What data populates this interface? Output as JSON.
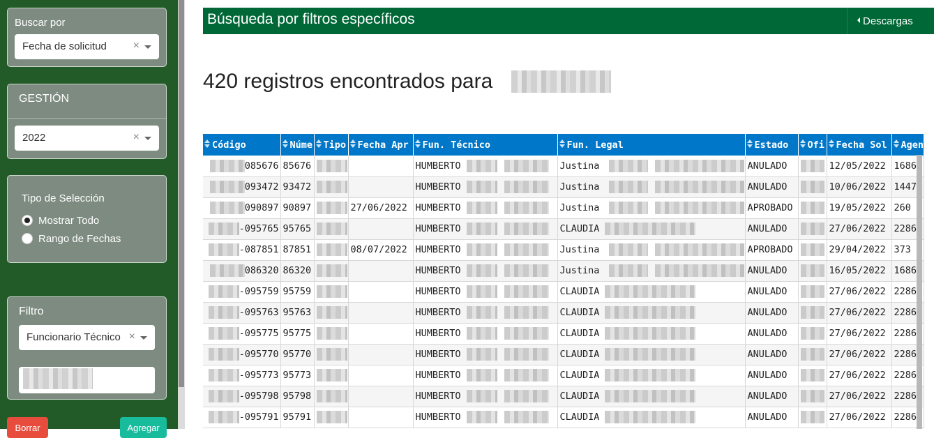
{
  "sidebar": {
    "buscar_por": {
      "label": "Buscar por",
      "value": "Fecha de solicitud",
      "clear": "×"
    },
    "gestion": {
      "label": "GESTIÓN",
      "value": "2022",
      "clear": "×"
    },
    "tipo_seleccion": {
      "label": "Tipo de Selección",
      "options": [
        {
          "label": "Mostrar Todo",
          "checked": true
        },
        {
          "label": "Rango de Fechas",
          "checked": false
        }
      ]
    },
    "filtro": {
      "label": "Filtro",
      "value": "Funcionario Técnico",
      "clear": "×",
      "text_value": ""
    },
    "buttons": {
      "borrar": "Borrar",
      "agregar": "Agregar"
    },
    "colors": {
      "bg": "#235b28",
      "panel": "#7d8b80",
      "borrar": "#e74c3c",
      "agregar": "#18bc9c"
    }
  },
  "header": {
    "title": "Búsqueda por filtros específicos",
    "download_button": "Descargas",
    "color": "#006837"
  },
  "results": {
    "count_text": "420 registros encontrados para"
  },
  "table": {
    "header_color": "#0077c8",
    "columns": [
      "Código",
      "Núme",
      "Tipo",
      "Fecha Apr",
      "Fun. Técnico",
      "Fun. Legal",
      "Estado",
      "Ofi",
      "Fecha Sol",
      "Agen"
    ],
    "rows": [
      {
        "codigo": "085676",
        "numero": "85676",
        "fecha_apr": "",
        "tecnico": "HUMBERTO",
        "legal": "Justina",
        "estado": "ANULADO",
        "fecha_sol": "12/05/2022",
        "agencia": "1686"
      },
      {
        "codigo": "093472",
        "numero": "93472",
        "fecha_apr": "",
        "tecnico": "HUMBERTO",
        "legal": "Justina",
        "estado": "ANULADO",
        "fecha_sol": "10/06/2022",
        "agencia": "1447"
      },
      {
        "codigo": "090897",
        "numero": "90897",
        "fecha_apr": "27/06/2022",
        "tecnico": "HUMBERTO",
        "legal": "Justina",
        "estado": "APROBADO",
        "fecha_sol": "19/05/2022",
        "agencia": "260"
      },
      {
        "codigo": "-095765",
        "numero": "95765",
        "fecha_apr": "",
        "tecnico": "HUMBERTO",
        "legal": "CLAUDIA",
        "estado": "ANULADO",
        "fecha_sol": "27/06/2022",
        "agencia": "2286"
      },
      {
        "codigo": "-087851",
        "numero": "87851",
        "fecha_apr": "08/07/2022",
        "tecnico": "HUMBERTO",
        "legal": "Justina",
        "estado": "APROBADO",
        "fecha_sol": "29/04/2022",
        "agencia": "373"
      },
      {
        "codigo": "086320",
        "numero": "86320",
        "fecha_apr": "",
        "tecnico": "HUMBERTO",
        "legal": "Justina",
        "estado": "ANULADO",
        "fecha_sol": "16/05/2022",
        "agencia": "1686"
      },
      {
        "codigo": "-095759",
        "numero": "95759",
        "fecha_apr": "",
        "tecnico": "HUMBERTO",
        "legal": "CLAUDIA",
        "estado": "ANULADO",
        "fecha_sol": "27/06/2022",
        "agencia": "2286"
      },
      {
        "codigo": "-095763",
        "numero": "95763",
        "fecha_apr": "",
        "tecnico": "HUMBERTO",
        "legal": "CLAUDIA",
        "estado": "ANULADO",
        "fecha_sol": "27/06/2022",
        "agencia": "2286"
      },
      {
        "codigo": "-095775",
        "numero": "95775",
        "fecha_apr": "",
        "tecnico": "HUMBERTO",
        "legal": "CLAUDIA",
        "estado": "ANULADO",
        "fecha_sol": "27/06/2022",
        "agencia": "2286"
      },
      {
        "codigo": "-095770",
        "numero": "95770",
        "fecha_apr": "",
        "tecnico": "HUMBERTO",
        "legal": "CLAUDIA",
        "estado": "ANULADO",
        "fecha_sol": "27/06/2022",
        "agencia": "2286"
      },
      {
        "codigo": "-095773",
        "numero": "95773",
        "fecha_apr": "",
        "tecnico": "HUMBERTO",
        "legal": "CLAUDIA",
        "estado": "ANULADO",
        "fecha_sol": "27/06/2022",
        "agencia": "2286"
      },
      {
        "codigo": "-095798",
        "numero": "95798",
        "fecha_apr": "",
        "tecnico": "HUMBERTO",
        "legal": "CLAUDIA",
        "estado": "ANULADO",
        "fecha_sol": "27/06/2022",
        "agencia": "2286"
      },
      {
        "codigo": "-095791",
        "numero": "95791",
        "fecha_apr": "",
        "tecnico": "HUMBERTO",
        "legal": "CLAUDIA",
        "estado": "ANULADO",
        "fecha_sol": "27/06/2022",
        "agencia": "2286"
      }
    ]
  }
}
